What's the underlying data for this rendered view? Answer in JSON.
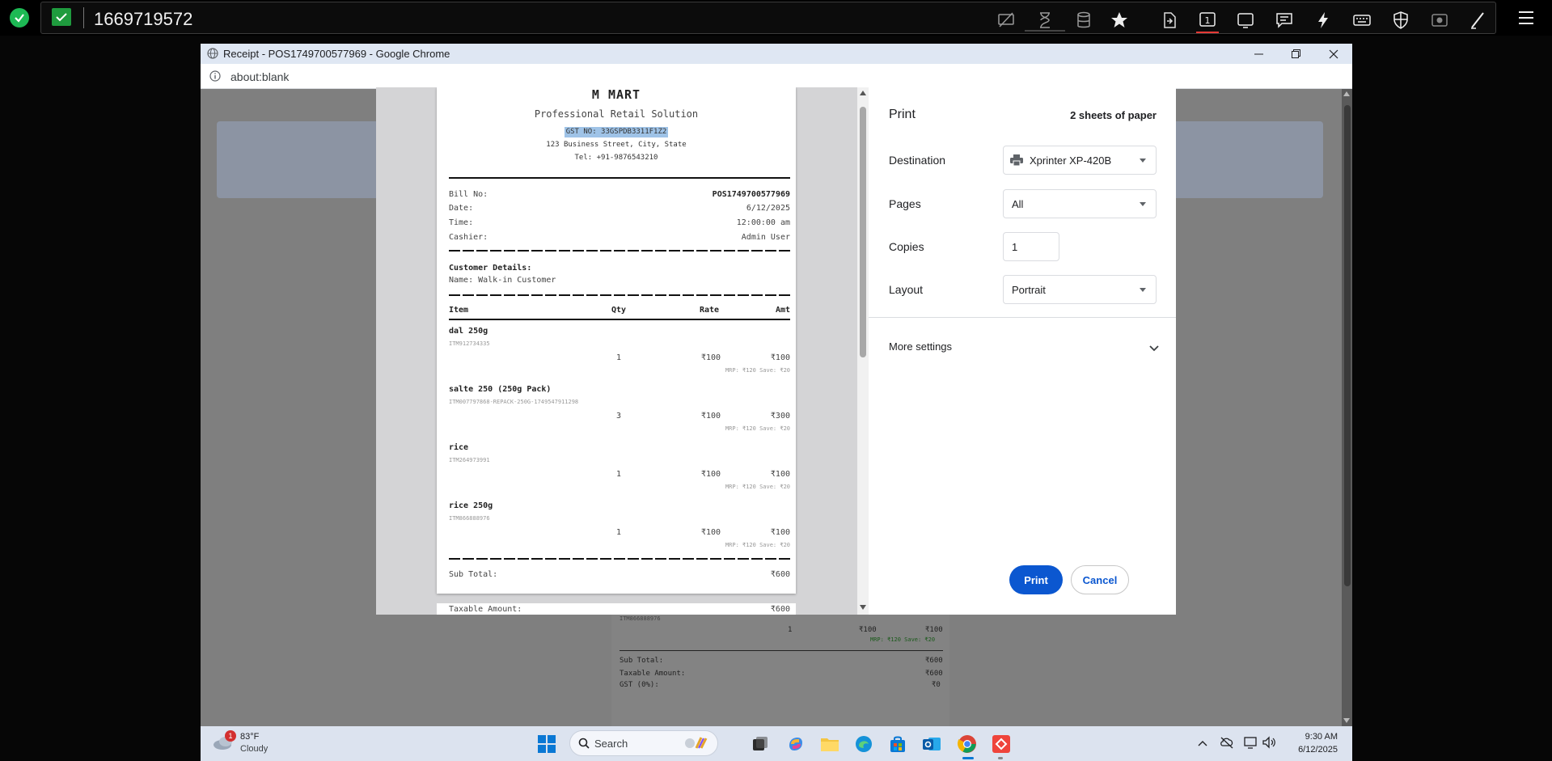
{
  "remote_bar": {
    "session_id": "1669719572",
    "active_monitor": "1"
  },
  "chrome": {
    "window_title": "Receipt - POS1749700577969 - Google Chrome",
    "address": "about:blank"
  },
  "print_dialog": {
    "title": "Print",
    "sheets": "2 sheets of paper",
    "destination_label": "Destination",
    "destination_value": "Xprinter XP-420B",
    "pages_label": "Pages",
    "pages_value": "All",
    "copies_label": "Copies",
    "copies_value": "1",
    "layout_label": "Layout",
    "layout_value": "Portrait",
    "more_settings": "More settings",
    "print_button": "Print",
    "cancel_button": "Cancel"
  },
  "receipt": {
    "store_name": "M MART",
    "tagline": "Professional Retail Solution",
    "gst": "GST NO: 33GSPDB3311F1Z2",
    "address": "123 Business Street, City, State",
    "tel": "Tel: +91-9876543210",
    "bill_no_label": "Bill No:",
    "bill_no": "POS1749700577969",
    "date_label": "Date:",
    "date": "6/12/2025",
    "time_label": "Time:",
    "time": "12:00:00 am",
    "cashier_label": "Cashier:",
    "cashier": "Admin User",
    "customer_heading": "Customer Details:",
    "customer_name": "Name: Walk-in Customer",
    "col_item": "Item",
    "col_qty": "Qty",
    "col_rate": "Rate",
    "col_amt": "Amt",
    "items": [
      {
        "name": "dal 250g",
        "code": "ITM912734335",
        "qty": "1",
        "rate": "₹100",
        "amt": "₹100",
        "mrp": "MRP: ₹120 Save: ₹20"
      },
      {
        "name": "salte 250 (250g Pack)",
        "code": "ITM007797868-REPACK-250G-1749547911298",
        "qty": "3",
        "rate": "₹100",
        "amt": "₹300",
        "mrp": "MRP: ₹120 Save: ₹20"
      },
      {
        "name": "rice",
        "code": "ITM264973991",
        "qty": "1",
        "rate": "₹100",
        "amt": "₹100",
        "mrp": "MRP: ₹120 Save: ₹20"
      },
      {
        "name": "rice 250g",
        "code": "ITM866888976",
        "qty": "1",
        "rate": "₹100",
        "amt": "₹100",
        "mrp": "MRP: ₹120 Save: ₹20"
      }
    ],
    "subtotal_label": "Sub Total:",
    "subtotal": "₹600",
    "taxable_label": "Taxable Amount:",
    "taxable": "₹600",
    "gst_label": "GST (0%):",
    "gst_value": "₹0"
  },
  "taskbar": {
    "temperature": "83°F",
    "weather": "Cloudy",
    "weather_badge": "1",
    "search_placeholder": "Search",
    "clock_time": "9:30 AM",
    "clock_date": "6/12/2025"
  }
}
